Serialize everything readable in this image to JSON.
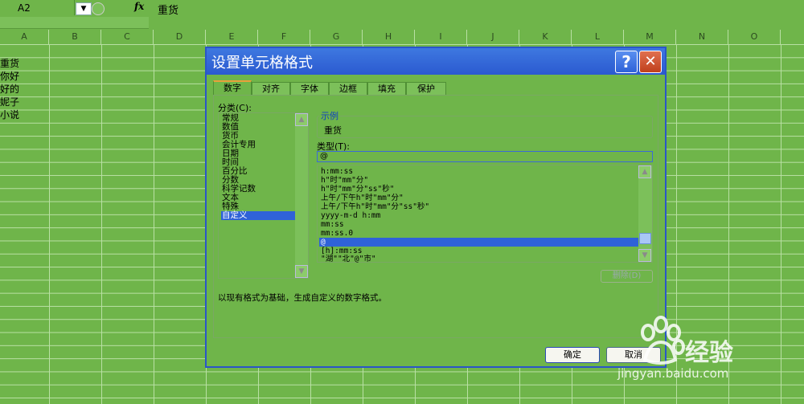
{
  "formula_bar": {
    "name_box": "A2",
    "dropdown_icon": "▼",
    "fx_label": "fx",
    "content": "重货"
  },
  "columns": [
    "A",
    "B",
    "C",
    "D",
    "E",
    "F",
    "G",
    "H",
    "I",
    "J",
    "K",
    "L",
    "M",
    "N",
    "O"
  ],
  "cells": [
    "重货",
    "你好",
    "好的",
    "妮子",
    "小说"
  ],
  "dialog": {
    "title": "设置单元格格式",
    "help_label": "?",
    "close_label": "✕",
    "tabs": [
      "数字",
      "对齐",
      "字体",
      "边框",
      "填充",
      "保护"
    ],
    "active_tab": "数字",
    "category_label": "分类(C):",
    "categories": [
      "常规",
      "数值",
      "货币",
      "会计专用",
      "日期",
      "时间",
      "百分比",
      "分数",
      "科学记数",
      "文本",
      "特殊",
      "自定义"
    ],
    "selected_category": "自定义",
    "sample_label": "示例",
    "sample_value": "重货",
    "type_label": "类型(T):",
    "type_input": "@",
    "type_list": [
      "h:mm:ss",
      "h\"时\"mm\"分\"",
      "h\"时\"mm\"分\"ss\"秒\"",
      "上午/下午h\"时\"mm\"分\"",
      "上午/下午h\"时\"mm\"分\"ss\"秒\"",
      "yyyy-m-d h:mm",
      "mm:ss",
      "mm:ss.0",
      "@",
      "[h]:mm:ss",
      "\"湖\"\"北\"@\"市\""
    ],
    "selected_type": "@",
    "delete_label": "删除(D)",
    "description": "以现有格式为基础，生成自定义的数字格式。",
    "ok_label": "确定",
    "cancel_label": "取消"
  },
  "watermark": {
    "logo_text": "经验",
    "url": "jingyan.baidu.com"
  },
  "colors": {
    "background": "#6fb54a",
    "title_bar": "#2b5ad0",
    "selection": "#2f62d8",
    "close_button": "#c0401c"
  }
}
